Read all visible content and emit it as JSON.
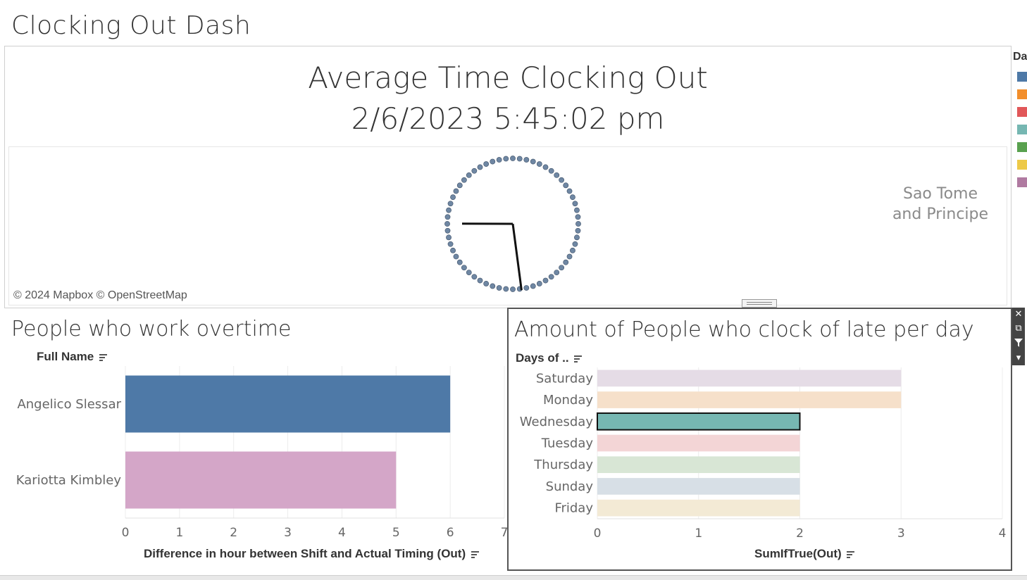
{
  "dashboard": {
    "title": "Clocking Out Dash"
  },
  "map_panel": {
    "title_line1": "Average Time Clocking Out",
    "title_line2": "2/6/2023 5:45:02 pm",
    "place_label_line1": "Sao Tome",
    "place_label_line2": "and Principe",
    "credit": "© 2024 Mapbox © OpenStreetMap",
    "clock_time": {
      "hour": 5,
      "minute": 45,
      "second": 2
    },
    "clock_color": "#6f87a3"
  },
  "legend": {
    "header": "Da",
    "colors": [
      "#4e79a7",
      "#f28e2b",
      "#e15759",
      "#76b7b2",
      "#59a14f",
      "#edc948",
      "#b07aa1"
    ]
  },
  "overtime_panel": {
    "title": "People who work overtime",
    "row_header": "Full Name",
    "x_axis_title": "Difference in hour between Shift and Actual Timing (Out)",
    "chart_data": {
      "type": "bar",
      "orientation": "horizontal",
      "categories": [
        "Angelico Slessar",
        "Kariotta Kimbley"
      ],
      "values": [
        6,
        5
      ],
      "colors": [
        "#4e79a7",
        "#d4a6c8"
      ],
      "xlim": [
        0,
        7
      ],
      "ticks": [
        "0",
        "1",
        "2",
        "3",
        "4",
        "5",
        "6",
        "7"
      ],
      "xlabel": "Difference in hour between Shift and Actual Timing (Out)",
      "grid": true
    }
  },
  "late_panel": {
    "title": "Amount of People who clock of late per day",
    "row_header": "Days of ..",
    "x_axis_title": "SumIfTrue(Out)",
    "chart_data": {
      "type": "bar",
      "orientation": "horizontal",
      "categories": [
        "Saturday",
        "Monday",
        "Wednesday",
        "Tuesday",
        "Thursday",
        "Sunday",
        "Friday"
      ],
      "values": [
        3,
        3,
        2,
        2,
        2,
        2,
        2
      ],
      "colors": [
        "#e5dce6",
        "#f6e0ca",
        "#76b7b2",
        "#f3d5d6",
        "#d8e6d5",
        "#d7dfe6",
        "#f3ead5"
      ],
      "selected": "Wednesday",
      "xlim": [
        0,
        4
      ],
      "ticks": [
        "0",
        "1",
        "2",
        "3",
        "4"
      ],
      "xlabel": "SumIfTrue(Out)",
      "grid": true
    }
  },
  "toolbar": {
    "icons": [
      "close-icon",
      "popout-icon",
      "filter-icon",
      "more-dropdown-icon"
    ]
  }
}
